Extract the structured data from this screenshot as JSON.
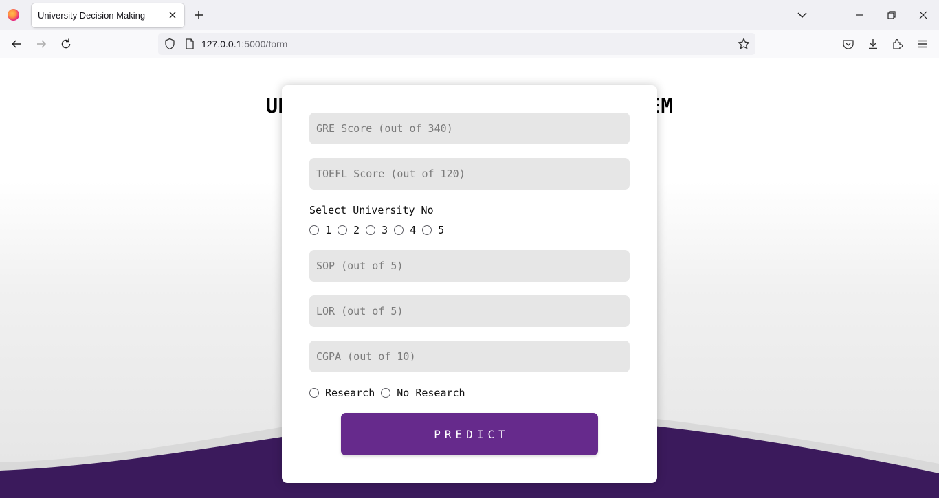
{
  "browser": {
    "tab_title": "University Decision Making",
    "url_host": "127.0.0.1",
    "url_rest": ":5000/form"
  },
  "page": {
    "heading": "UNIVERSITY DECISION MAKING SYSTEM"
  },
  "form": {
    "gre_placeholder": "GRE Score (out of 340)",
    "toefl_placeholder": "TOEFL Score (out of 120)",
    "university_label": "Select University No",
    "university_options": [
      "1",
      "2",
      "3",
      "4",
      "5"
    ],
    "sop_placeholder": "SOP (out of 5)",
    "lor_placeholder": "LOR (out of 5)",
    "cgpa_placeholder": "CGPA (out of 10)",
    "research_yes": "Research",
    "research_no": "No Research",
    "submit_label": "PREDICT"
  },
  "colors": {
    "accent": "#662a8c",
    "wave": "#3b1a5c"
  }
}
